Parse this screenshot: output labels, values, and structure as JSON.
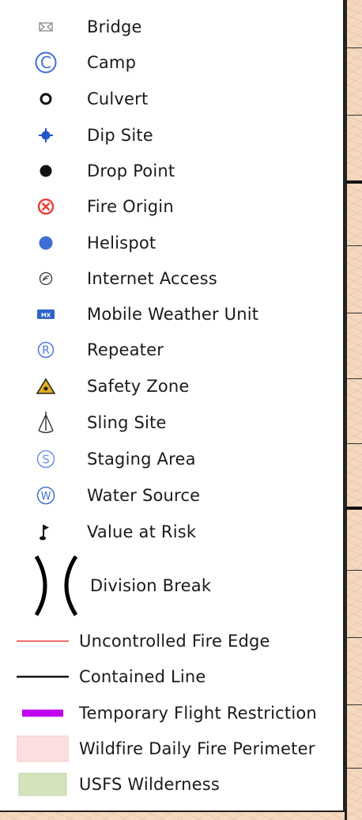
{
  "legend": {
    "items": [
      {
        "key": "bridge",
        "label": "Bridge",
        "icon": "bridge-icon"
      },
      {
        "key": "camp",
        "label": "Camp",
        "icon": "camp-icon"
      },
      {
        "key": "culvert",
        "label": "Culvert",
        "icon": "culvert-icon"
      },
      {
        "key": "dip_site",
        "label": "Dip Site",
        "icon": "dip-site-icon"
      },
      {
        "key": "drop_point",
        "label": "Drop Point",
        "icon": "drop-point-icon"
      },
      {
        "key": "fire_origin",
        "label": "Fire Origin",
        "icon": "fire-origin-icon"
      },
      {
        "key": "helispot",
        "label": "Helispot",
        "icon": "helispot-icon"
      },
      {
        "key": "internet_access",
        "label": "Internet Access",
        "icon": "internet-access-icon"
      },
      {
        "key": "mobile_weather_unit",
        "label": "Mobile Weather Unit",
        "icon": "mobile-weather-unit-icon"
      },
      {
        "key": "repeater",
        "label": "Repeater",
        "icon": "repeater-icon"
      },
      {
        "key": "safety_zone",
        "label": "Safety Zone",
        "icon": "safety-zone-icon"
      },
      {
        "key": "sling_site",
        "label": "Sling Site",
        "icon": "sling-site-icon"
      },
      {
        "key": "staging_area",
        "label": "Staging Area",
        "icon": "staging-area-icon"
      },
      {
        "key": "water_source",
        "label": "Water Source",
        "icon": "water-source-icon"
      },
      {
        "key": "value_at_risk",
        "label": "Value at Risk",
        "icon": "value-at-risk-icon"
      },
      {
        "key": "division_break",
        "label": "Division Break",
        "icon": "division-break-icon"
      },
      {
        "key": "uncontrolled_fire_edge",
        "label": "Uncontrolled Fire Edge",
        "icon": "uncontrolled-fire-edge-line",
        "color": "#e8413a"
      },
      {
        "key": "contained_line",
        "label": "Contained Line",
        "icon": "contained-line",
        "color": "#111111"
      },
      {
        "key": "temporary_flight_restriction",
        "label": "Temporary Flight Restriction",
        "icon": "tfr-line",
        "color": "#c000f0"
      },
      {
        "key": "wildfire_daily_fire_perimeter",
        "label": "Wildfire Daily Fire Perimeter",
        "icon": "fire-perimeter-swatch",
        "color": "#fcdede"
      },
      {
        "key": "usfs_wilderness",
        "label": "USFS Wilderness",
        "icon": "wilderness-swatch",
        "color": "#d3e3bc"
      }
    ]
  },
  "icon_text": {
    "camp": "C",
    "repeater": "R",
    "staging": "S",
    "water": "W",
    "mwu": "MX"
  },
  "colors": {
    "icon_blue": "#3f6fd6",
    "fire_red": "#e8413a",
    "safety_yellow": "#e0b020",
    "tfr_purple": "#c000f0",
    "perimeter_fill": "#fcdede",
    "wilderness_fill": "#d3e3bc",
    "map_background": "#f4d8bf"
  }
}
